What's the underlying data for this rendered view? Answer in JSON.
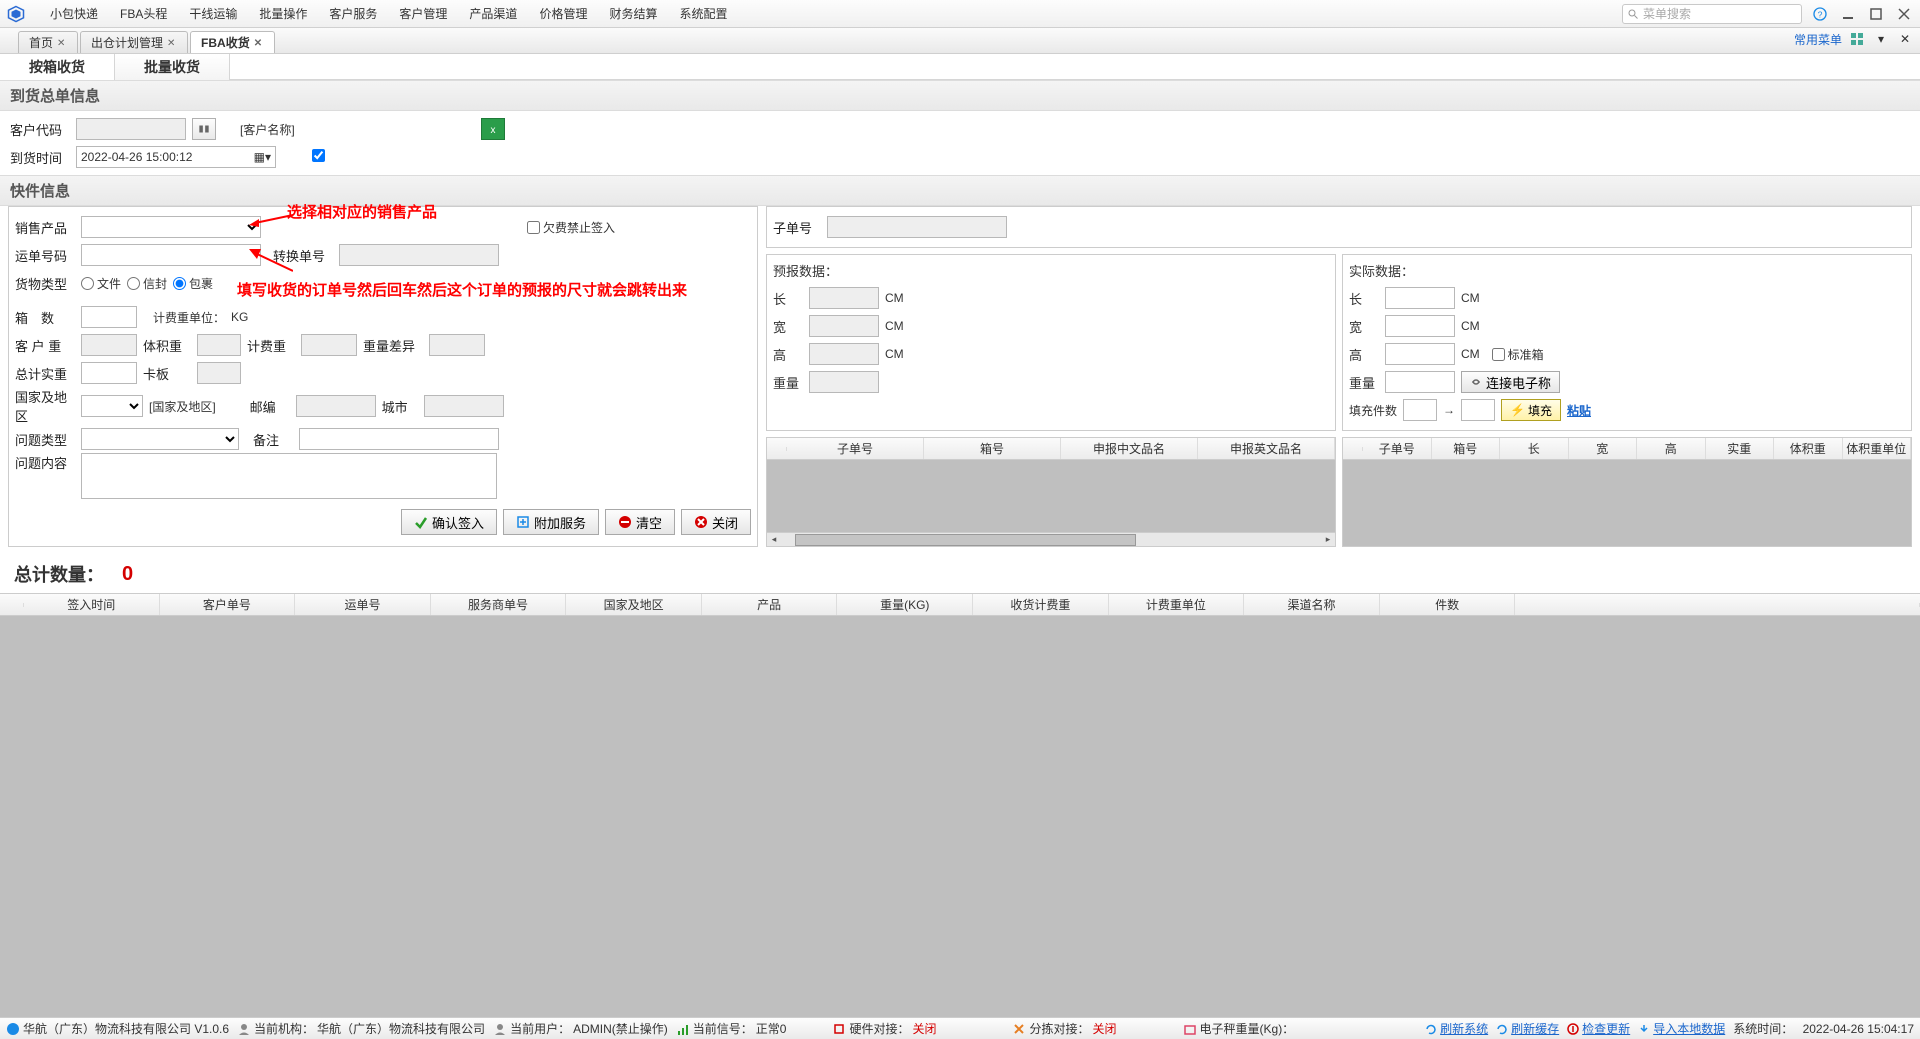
{
  "menu": [
    "小包快递",
    "FBA头程",
    "干线运输",
    "批量操作",
    "客户服务",
    "客户管理",
    "产品渠道",
    "价格管理",
    "财务结算",
    "系统配置"
  ],
  "search_placeholder": "菜单搜索",
  "tabs": [
    {
      "label": "首页",
      "active": false
    },
    {
      "label": "出仓计划管理",
      "active": false
    },
    {
      "label": "FBA收货",
      "active": true
    }
  ],
  "tabbar_link": "常用菜单",
  "subtabs": [
    {
      "label": "按箱收货",
      "active": true
    },
    {
      "label": "批量收货",
      "active": false
    }
  ],
  "sec_arrival": "到货总单信息",
  "sec_express": "快件信息",
  "f": {
    "cust_code": "客户代码",
    "cust_name": "[客户名称]",
    "arrival_time": "到货时间",
    "arrival_val": "2022-04-26 15:00:12",
    "sale_prod": "销售产品",
    "arrear_block": "欠费禁止签入",
    "waybill": "运单号码",
    "convert": "转换单号",
    "goods_type": "货物类型",
    "g_file": "文件",
    "g_env": "信封",
    "g_pkg": "包裹",
    "boxes": "箱　数",
    "bill_unit": "计费重单位：",
    "bill_unit_v": "KG",
    "cust_w": "客 户 重",
    "vol_w": "体积重",
    "bill_w": "计费重",
    "w_diff": "重量差异",
    "total_w": "总计实重",
    "pallet": "卡板",
    "country": "国家及地区",
    "country_ph": "[国家及地区]",
    "postcode": "邮编",
    "city": "城市",
    "issue_type": "问题类型",
    "remark": "备注",
    "issue_content": "问题内容"
  },
  "annot1": "选择相对应的销售产品",
  "annot2": "填写收货的订单号然后回车然后这个订单的预报的尺寸就会跳转出来",
  "btns": {
    "confirm": "确认签入",
    "addon": "附加服务",
    "clear": "清空",
    "close": "关闭"
  },
  "sub": {
    "sub_no": "子单号",
    "forecast": "预报数据：",
    "actual": "实际数据：",
    "len": "长",
    "wid": "宽",
    "hei": "高",
    "wt": "重量",
    "cm": "CM",
    "std_box": "标准箱",
    "connect_scale": "连接电子称",
    "fill_count": "填充件数",
    "fill": "填充",
    "paste": "粘贴"
  },
  "grid1_h": [
    "子单号",
    "箱号",
    "申报中文品名",
    "申报英文品名"
  ],
  "grid2_h": [
    "子单号",
    "箱号",
    "长",
    "宽",
    "高",
    "实重",
    "体积重",
    "体积重单位"
  ],
  "total_label": "总计数量：",
  "total_value": "0",
  "biggrid_h": [
    "签入时间",
    "客户单号",
    "运单号",
    "服务商单号",
    "国家及地区",
    "产品",
    "重量(KG)",
    "收货计费重",
    "计费重单位",
    "渠道名称",
    "件数"
  ],
  "status": {
    "company": "华航（广东）物流科技有限公司 V1.0.6",
    "org_l": "当前机构：",
    "org_v": "华航（广东）物流科技有限公司",
    "user_l": "当前用户：",
    "user_v": "ADMIN(禁止操作)",
    "sig_l": "当前信号：",
    "sig_v": "正常0",
    "hw_l": "硬件对接：",
    "hw_v": "关闭",
    "sort_l": "分拣对接：",
    "sort_v": "关闭",
    "scale_l": "电子秤重量(Kg)：",
    "links": [
      "刷新系统",
      "刷新缓存",
      "检查更新",
      "导入本地数据"
    ],
    "time_l": "系统时间：",
    "time_v": "2022-04-26 15:04:17"
  }
}
